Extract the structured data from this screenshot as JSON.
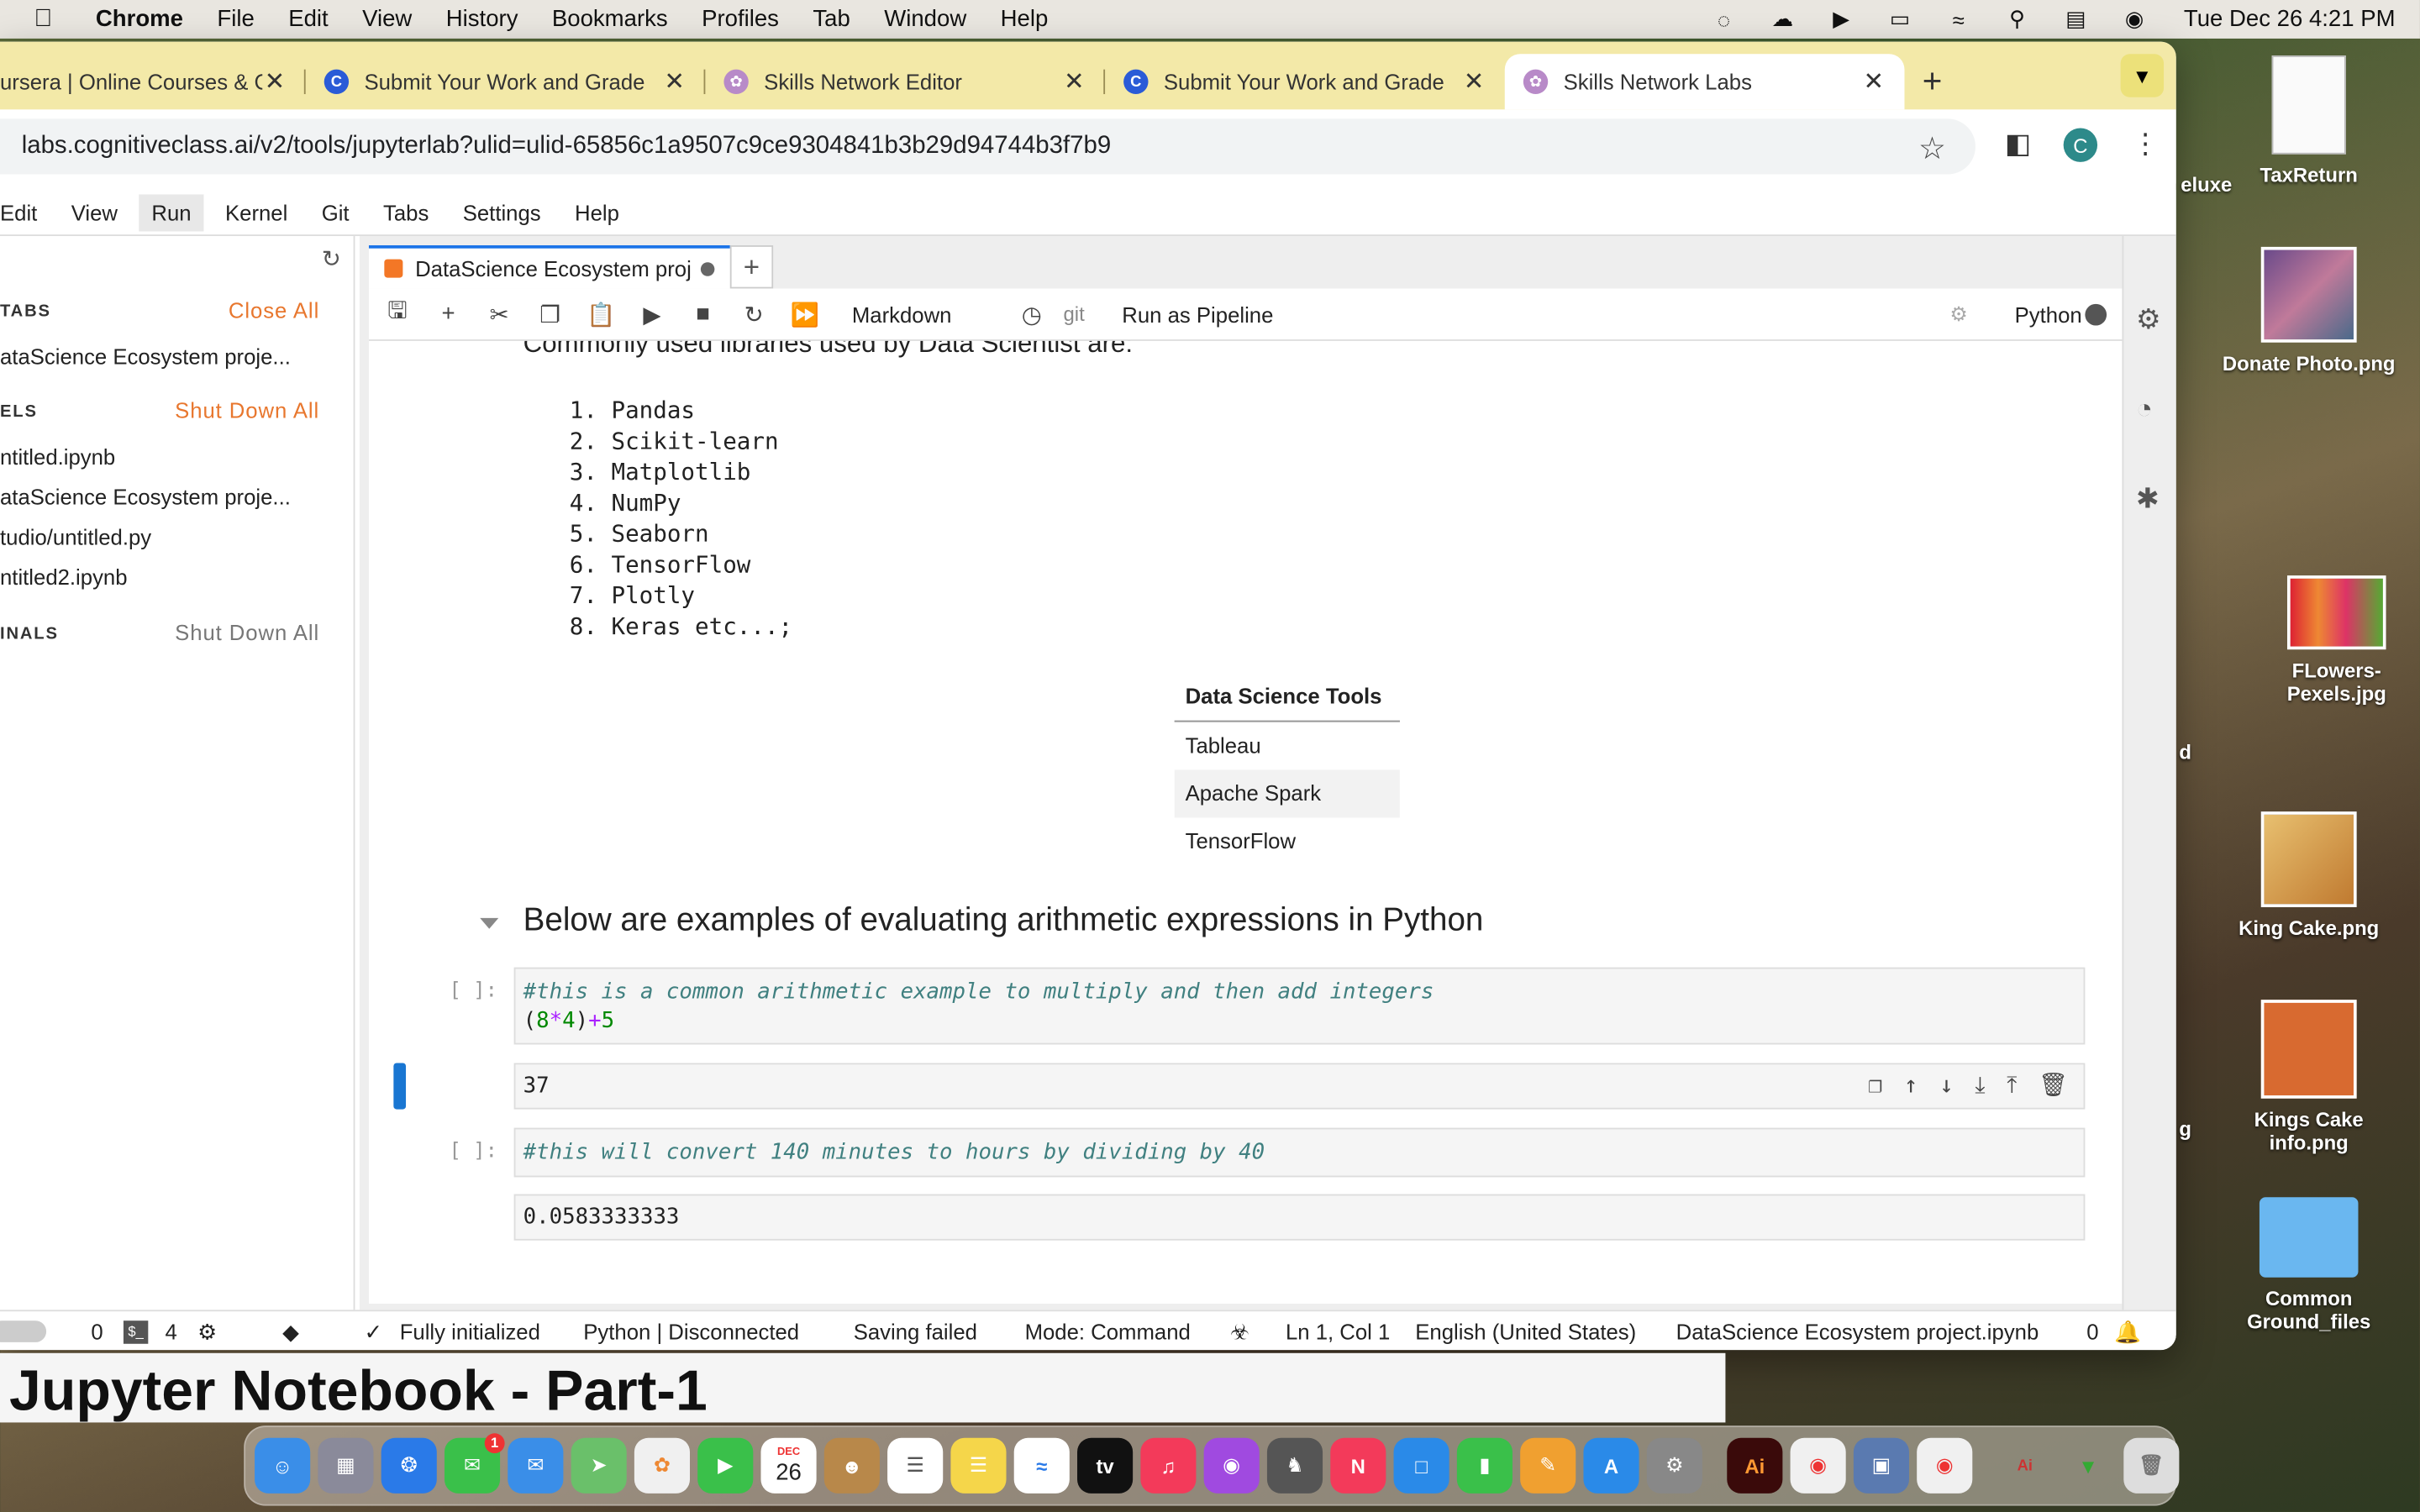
{
  "menubar": {
    "app": "Chrome",
    "items": [
      "File",
      "Edit",
      "View",
      "History",
      "Bookmarks",
      "Profiles",
      "Tab",
      "Window",
      "Help"
    ],
    "clock": "Tue Dec 26  4:21 PM"
  },
  "tabs": [
    {
      "title": "ursera | Online Courses & C",
      "icon": "coursera"
    },
    {
      "title": "Submit Your Work and Grade",
      "icon": "coursera"
    },
    {
      "title": "Skills Network Editor",
      "icon": "skills-network"
    },
    {
      "title": "Submit Your Work and Grade",
      "icon": "coursera"
    },
    {
      "title": "Skills Network Labs",
      "icon": "skills-network"
    }
  ],
  "address": {
    "url": "labs.cognitiveclass.ai/v2/tools/jupyterlab?ulid=ulid-65856c1a9507c9ce9304841b3b29d94744b3f7b9"
  },
  "profile": {
    "initial": "C"
  },
  "jupyter_menu": [
    "Edit",
    "View",
    "Run",
    "Kernel",
    "Git",
    "Tabs",
    "Settings",
    "Help"
  ],
  "left_panel": {
    "tabs_header": "TABS",
    "close_all": "Close All",
    "tab_items": [
      "ataScience Ecosystem proje..."
    ],
    "kernels_header": "ELS",
    "shut_down_all": "Shut Down All",
    "kernel_items": [
      "ntitled.ipynb",
      "ataScience Ecosystem proje...",
      "tudio/untitled.py",
      "ntitled2.ipynb"
    ],
    "terminals_header": "INALS",
    "terminals_shutdown": "Shut Down All"
  },
  "doc_tab": {
    "title": "DataScience Ecosystem proj"
  },
  "nb_toolbar": {
    "cell_type": "Markdown",
    "git": "git",
    "pipeline": "Run as Pipeline",
    "kernel": "Python"
  },
  "notebook": {
    "cut_line": "Commonly used libraries used by Data Scientist are:",
    "libraries": [
      "1. Pandas",
      "2. Scikit-learn",
      "3. Matplotlib",
      "4. NumPy",
      "5. Seaborn",
      "6. TensorFlow",
      "7. Plotly",
      "8. Keras etc...;"
    ],
    "table_header": "Data Science Tools",
    "table_rows": [
      "Tableau",
      "Apache Spark",
      "TensorFlow"
    ],
    "heading": "Below are examples of evaluating arithmetic expressions in Python",
    "cell1": {
      "prompt": "[ ]:",
      "comment": "#this is a common arithmetic example to multiply and then add integers",
      "code": "(8*4)+5"
    },
    "cell1_output": "37",
    "cell2": {
      "prompt": "[ ]:",
      "comment": "#this will convert 140 minutes to hours by dividing by 40"
    },
    "cell2_output": "0.0583333333"
  },
  "status": {
    "zero1": "0",
    "term_count": "4",
    "initialized": "Fully initialized",
    "kernel_status": "Python | Disconnected",
    "saving": "Saving failed",
    "mode": "Mode: Command",
    "position": "Ln 1, Col 1",
    "language": "English (United States)",
    "filename": "DataScience Ecosystem project.ipynb",
    "notifications": "0"
  },
  "behind_window": {
    "heading": "Jupyter Notebook - Part-1"
  },
  "desktop": [
    {
      "label": "TaxReturn"
    },
    {
      "label": "Donate Photo.png"
    },
    {
      "label": "FLowers-Pexels.jpg"
    },
    {
      "label": "King Cake.png"
    },
    {
      "label": "Kings Cake info.png"
    },
    {
      "label": "Common Ground_files"
    }
  ],
  "desktop_partial": [
    "eluxe",
    "d",
    "g"
  ],
  "dock": {
    "calendar_month": "DEC",
    "calendar_day": "26",
    "messages_badge": "1"
  },
  "colors": {
    "tabstrip": "#f3e9a8",
    "accent_orange": "#e8772e",
    "selection_blue": "#1976d2"
  }
}
